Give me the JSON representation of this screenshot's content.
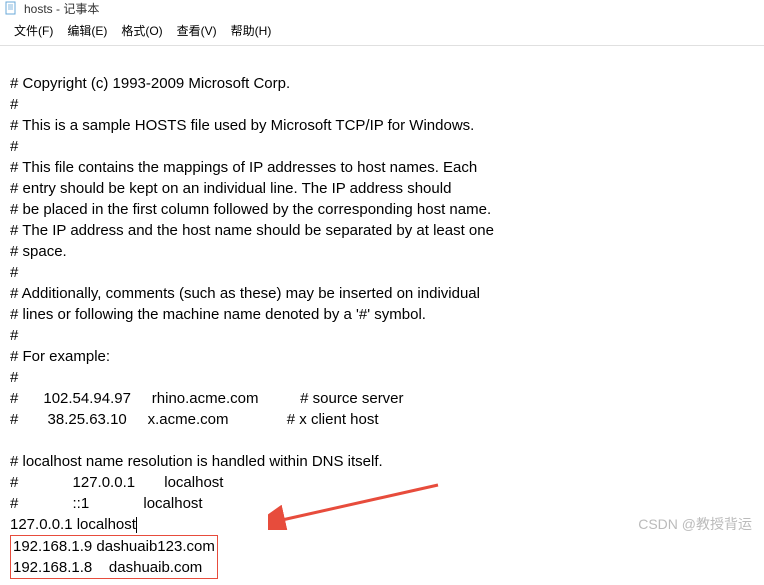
{
  "titlebar": {
    "title": "hosts - 记事本"
  },
  "menu": {
    "file": "文件(F)",
    "edit": "编辑(E)",
    "format": "格式(O)",
    "view": "查看(V)",
    "help": "帮助(H)"
  },
  "content": {
    "line1": "# Copyright (c) 1993-2009 Microsoft Corp.",
    "line2": "#",
    "line3": "# This is a sample HOSTS file used by Microsoft TCP/IP for Windows.",
    "line4": "#",
    "line5": "# This file contains the mappings of IP addresses to host names. Each",
    "line6": "# entry should be kept on an individual line. The IP address should",
    "line7": "# be placed in the first column followed by the corresponding host name.",
    "line8": "# The IP address and the host name should be separated by at least one",
    "line9": "# space.",
    "line10": "#",
    "line11": "# Additionally, comments (such as these) may be inserted on individual",
    "line12": "# lines or following the machine name denoted by a '#' symbol.",
    "line13": "#",
    "line14": "# For example:",
    "line15": "#",
    "line16": "#      102.54.94.97     rhino.acme.com          # source server",
    "line17": "#       38.25.63.10     x.acme.com              # x client host",
    "line18": "",
    "line19": "# localhost name resolution is handled within DNS itself.",
    "line20": "#             127.0.0.1       localhost",
    "line21": "#             ::1             localhost",
    "line22": "127.0.0.1 localhost",
    "line23": "192.168.1.9 dashuaib123.com",
    "line24": "192.168.1.8    dashuaib.com"
  },
  "watermark": "CSDN @教授背运"
}
